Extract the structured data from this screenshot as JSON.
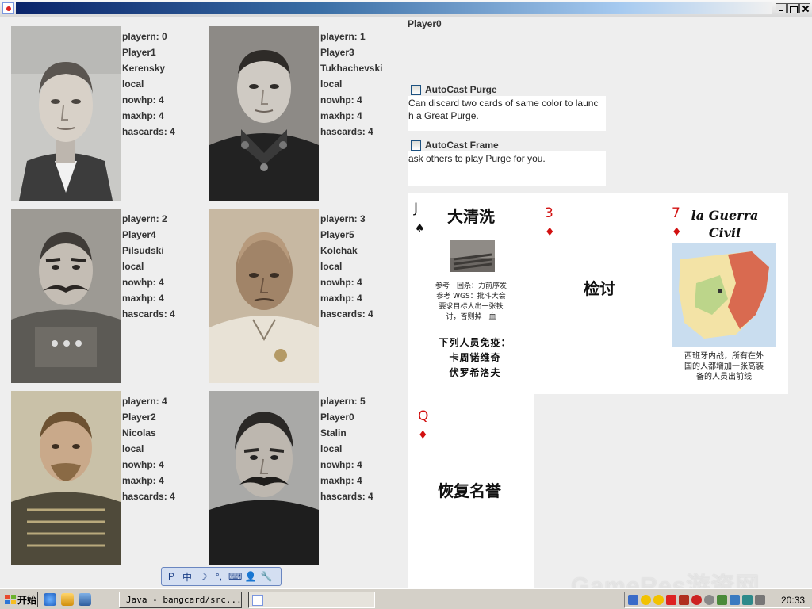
{
  "window": {
    "title": ""
  },
  "current_player": "Player0",
  "players": [
    {
      "playern": "playern: 0",
      "name": "Player1",
      "character": "Kerensky",
      "mode": "local",
      "nowhp": "nowhp: 4",
      "maxhp": "maxhp: 4",
      "hascards": "hascards: 4"
    },
    {
      "playern": "playern: 1",
      "name": "Player3",
      "character": "Tukhachevski",
      "mode": "local",
      "nowhp": "nowhp: 4",
      "maxhp": "maxhp: 4",
      "hascards": "hascards: 4"
    },
    {
      "playern": "playern: 2",
      "name": "Player4",
      "character": "Pilsudski",
      "mode": "local",
      "nowhp": "nowhp: 4",
      "maxhp": "maxhp: 4",
      "hascards": "hascards: 4"
    },
    {
      "playern": "playern: 3",
      "name": "Player5",
      "character": "Kolchak",
      "mode": "local",
      "nowhp": "nowhp: 4",
      "maxhp": "maxhp: 4",
      "hascards": "hascards: 4"
    },
    {
      "playern": "playern: 4",
      "name": "Player2",
      "character": "Nicolas",
      "mode": "local",
      "nowhp": "nowhp: 4",
      "maxhp": "maxhp: 4",
      "hascards": "hascards: 4"
    },
    {
      "playern": "playern: 5",
      "name": "Player0",
      "character": "Stalin",
      "mode": "local",
      "nowhp": "nowhp: 4",
      "maxhp": "maxhp: 4",
      "hascards": "hascards: 4"
    }
  ],
  "autocast_purge": {
    "label": "AutoCast Purge",
    "checked": false,
    "desc_line1": "Can discard two cards of same color to launc",
    "desc_line2": "h a Great Purge."
  },
  "autocast_frame": {
    "label": "AutoCast Frame",
    "checked": false,
    "desc_line1": "ask others to play Purge for you."
  },
  "cards": [
    {
      "rank": "J",
      "suit": "♠",
      "suit_color": "black",
      "title": "大清洗",
      "small_lines": [
        "参考一回杀：力前序发",
        "参考 WGS：批斗大会",
        "要求目标人出一张铁",
        "讨，否则掉一血"
      ],
      "mid_lines": [
        "下列人员免疫：",
        "卡周锘维奇",
        "伏罗希洛夫"
      ]
    },
    {
      "rank": "3",
      "suit": "♦",
      "suit_color": "red",
      "title": "检讨"
    },
    {
      "rank": "7",
      "suit": "♦",
      "suit_color": "red",
      "title_line1": "la Guerra",
      "title_line2": "Civil",
      "small_lines": [
        "西班牙内战，所有在外",
        "国的人都增加一张高装",
        "备的人员出前线"
      ]
    },
    {
      "rank": "Q",
      "suit": "♦",
      "suit_color": "red",
      "title": "恢复名誉"
    }
  ],
  "ime": {
    "icons": [
      "P",
      "中",
      "☽",
      "°,",
      "⌨",
      "👤",
      "🔧"
    ]
  },
  "taskbar": {
    "start_label": "开始",
    "task1": "Java - bangcard/src...",
    "task2": "",
    "clock": "20:33"
  },
  "watermark": "GameRes游资网",
  "colors": {
    "red_suit": "#d21010",
    "panel_bg": "#eeeeee",
    "desc_bg": "#ffffff"
  }
}
